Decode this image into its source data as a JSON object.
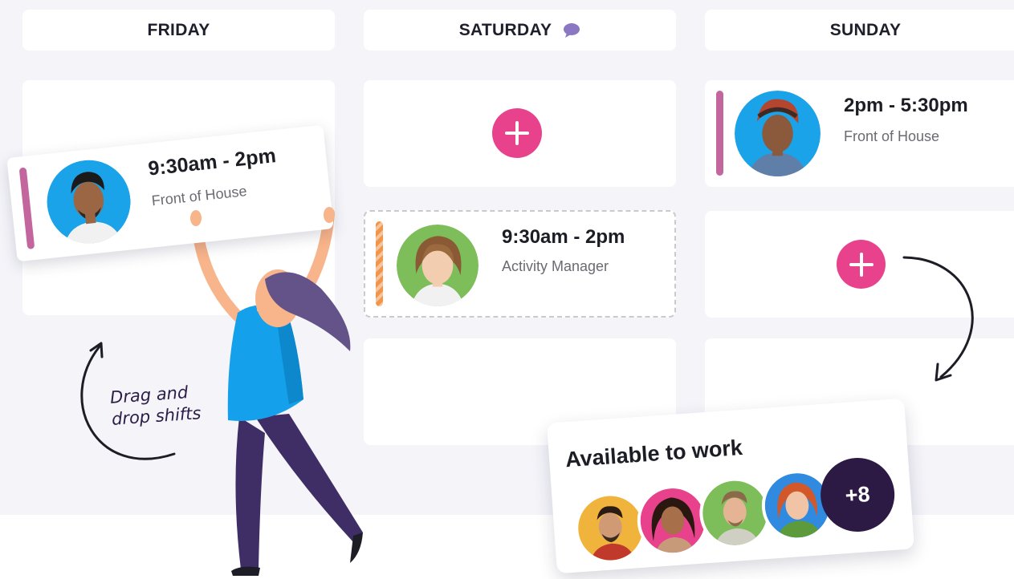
{
  "days": {
    "friday": {
      "label": "FRIDAY"
    },
    "saturday": {
      "label": "SATURDAY",
      "icon": "chat-bubble-icon"
    },
    "sunday": {
      "label": "SUNDAY"
    }
  },
  "shifts": {
    "friday_drag": {
      "time": "9:30am - 2pm",
      "role": "Front of House",
      "bar_color": "#c4669e",
      "avatar_bg": "#1aa3e8"
    },
    "saturday_pending": {
      "time": "9:30am - 2pm",
      "role": "Activity Manager",
      "bar_color": "#f0954a",
      "avatar_bg": "#7dbd5a"
    },
    "sunday_shift": {
      "time": "2pm - 5:30pm",
      "role": "Front of House",
      "bar_color": "#c4669e",
      "avatar_bg": "#1aa3e8"
    }
  },
  "available": {
    "title": "Available to work",
    "more_count": "+8",
    "avatars": [
      {
        "bg": "#f0b43c"
      },
      {
        "bg": "#e8428c"
      },
      {
        "bg": "#7dbd5a"
      },
      {
        "bg": "#2f8ae0"
      }
    ]
  },
  "annotation": {
    "line1": "Drag and",
    "line2": "drop shifts"
  },
  "colors": {
    "accent_pink": "#e8428c",
    "board_bg": "#f4f4f9",
    "badge_dark": "#2c1a45"
  }
}
